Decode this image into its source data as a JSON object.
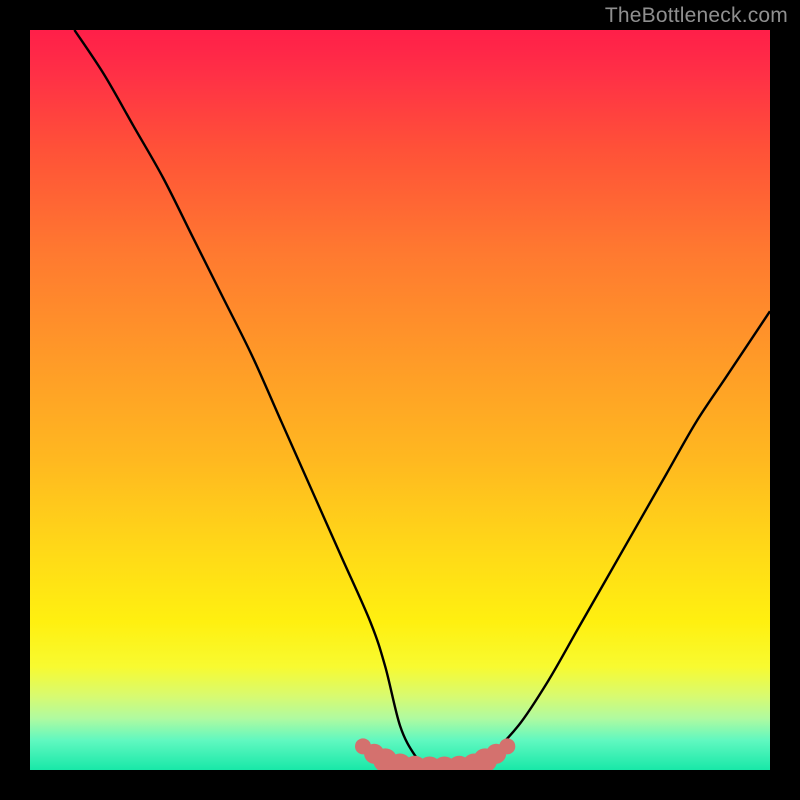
{
  "watermark": "TheBottleneck.com",
  "chart_data": {
    "type": "line",
    "title": "",
    "xlabel": "",
    "ylabel": "",
    "xlim": [
      0,
      100
    ],
    "ylim": [
      0,
      100
    ],
    "series": [
      {
        "name": "bottleneck-curve",
        "x": [
          6,
          10,
          14,
          18,
          22,
          26,
          30,
          34,
          38,
          42,
          46,
          48,
          50,
          52,
          54,
          58,
          62,
          66,
          70,
          74,
          78,
          82,
          86,
          90,
          94,
          98,
          100
        ],
        "values": [
          100,
          94,
          87,
          80,
          72,
          64,
          56,
          47,
          38,
          29,
          20,
          14,
          6,
          2,
          0,
          0,
          2,
          6,
          12,
          19,
          26,
          33,
          40,
          47,
          53,
          59,
          62
        ]
      }
    ],
    "markers": {
      "name": "valley-dots",
      "color": "#d4716e",
      "x": [
        45,
        46.5,
        48,
        50,
        52,
        54,
        56,
        58,
        60,
        61.5,
        63,
        64.5
      ],
      "values": [
        3.2,
        2.2,
        1.3,
        0.6,
        0.3,
        0.2,
        0.2,
        0.3,
        0.6,
        1.3,
        2.2,
        3.2
      ],
      "sizes": [
        8,
        10,
        12,
        12,
        12,
        12,
        12,
        12,
        12,
        12,
        10,
        8
      ]
    }
  }
}
